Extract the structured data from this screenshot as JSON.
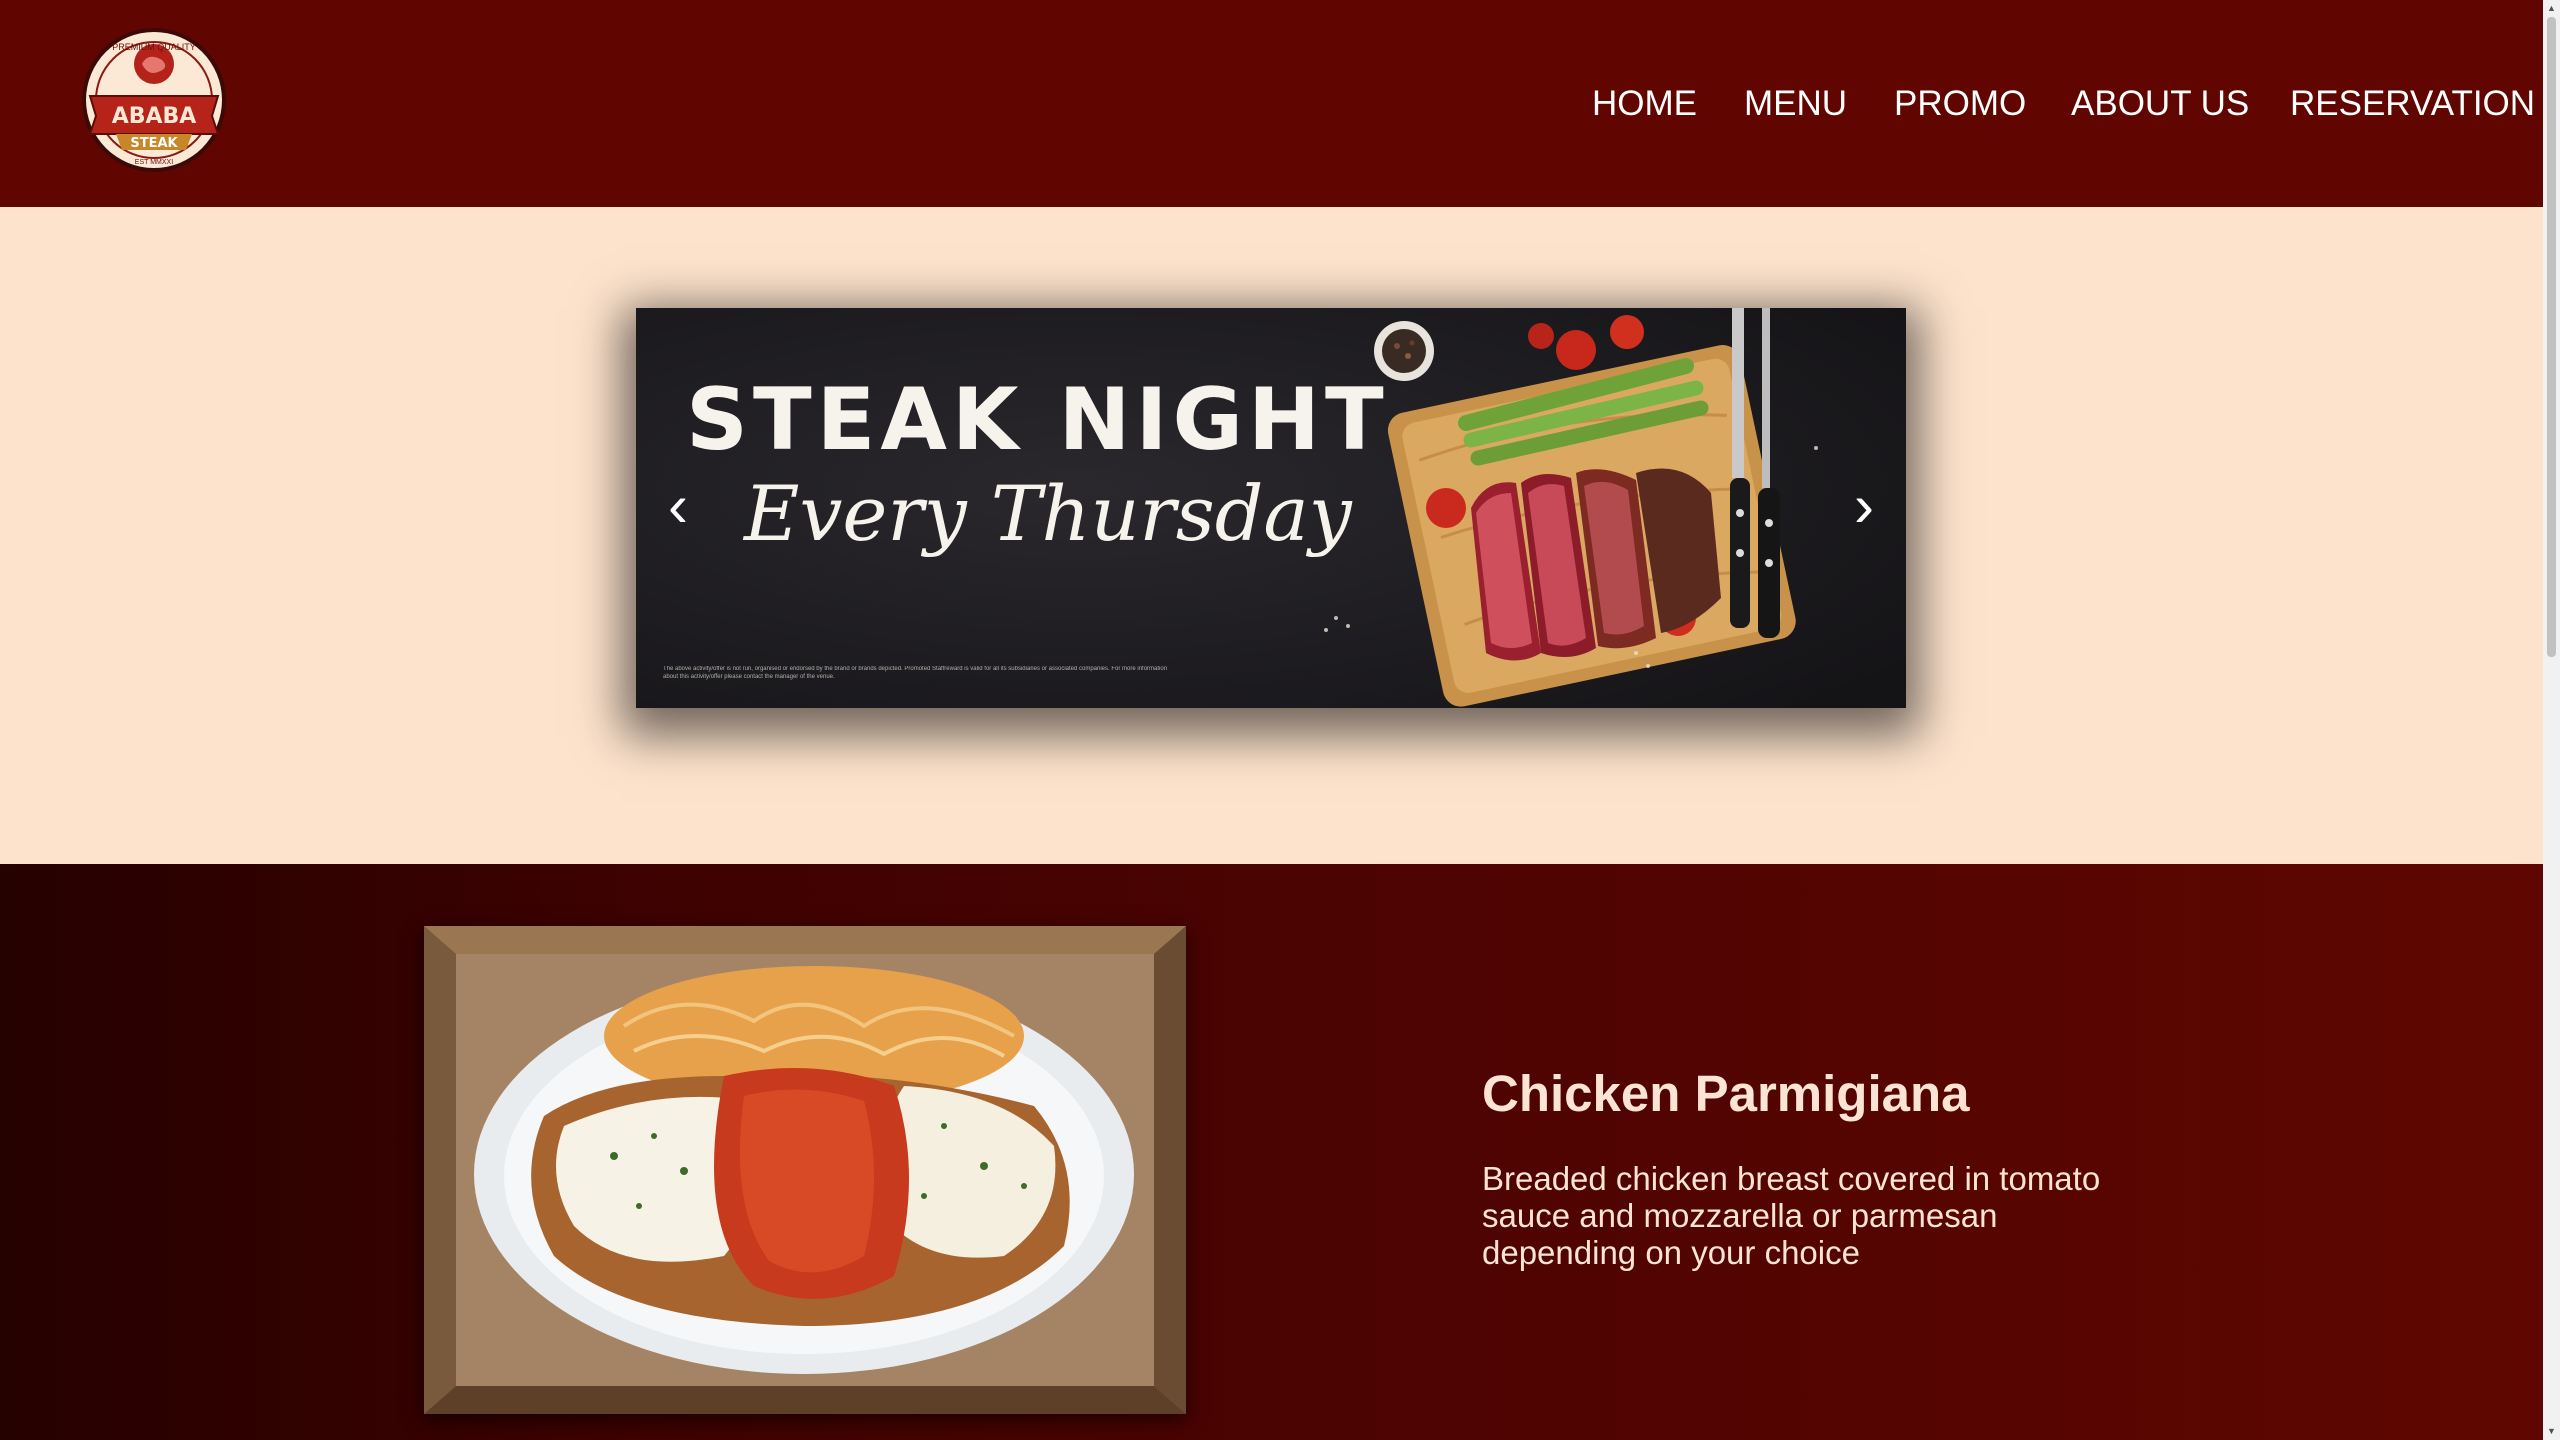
{
  "brand": {
    "logo_top_text": "PREMIUM QUALITY",
    "logo_name_1": "ABABA",
    "logo_name_2": "STEAK",
    "logo_est": "EST MMXXI"
  },
  "nav": {
    "items": [
      {
        "label": "HOME"
      },
      {
        "label": "MENU"
      },
      {
        "label": "PROMO"
      },
      {
        "label": "ABOUT US"
      },
      {
        "label": "RESERVATION"
      }
    ]
  },
  "hero": {
    "title": "STEAK NIGHT",
    "subtitle": "Every Thursday",
    "fine_print": "The above activity/offer is not run, organised or endorsed by the brand or brands depicted. Promoted Staffreward is valid for all its subsidiaries or associated companies. For more information about this activity/offer please contact the manager of the venue.",
    "prev_arrow": "‹",
    "next_arrow": "›"
  },
  "featured": {
    "title": "Chicken Parmigiana",
    "description": "Breaded chicken breast covered in tomato sauce and mozzarella or parmesan depending on your choice"
  },
  "icons": {
    "logo": "steak-badge-logo",
    "prev": "chevron-left-icon",
    "next": "chevron-right-icon"
  },
  "colors": {
    "header_bg": "#610500",
    "hero_bg": "#fde3cc",
    "feature_bg_dark": "#250100",
    "feature_bg_light": "#5f0600",
    "text_light": "#fbe4d4"
  }
}
